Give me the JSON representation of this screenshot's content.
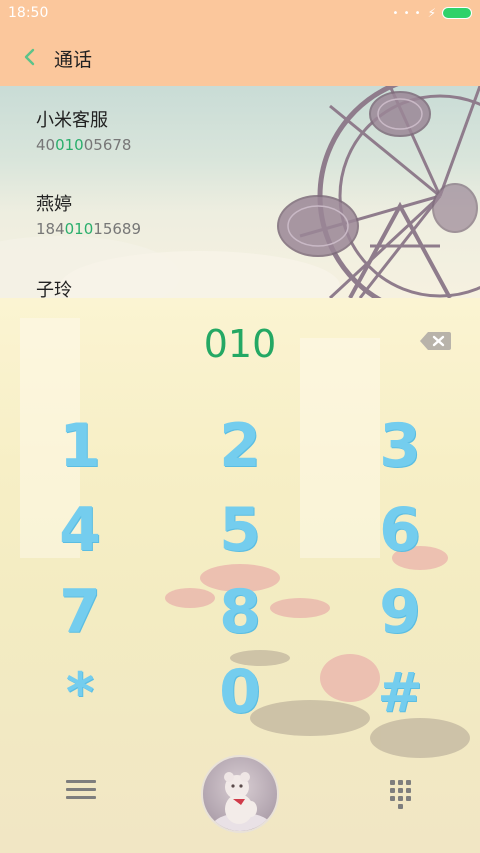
{
  "status_bar": {
    "time": "18:50"
  },
  "header": {
    "title": "通话"
  },
  "contacts": [
    {
      "name": "小米客服",
      "number_prefix": "40",
      "number_match": "010",
      "number_suffix": "05678"
    },
    {
      "name": "燕婷",
      "number_prefix": "184",
      "number_match": "010",
      "number_suffix": "15689"
    },
    {
      "name": "子玲",
      "number_prefix": "",
      "number_match": "",
      "number_suffix": ""
    }
  ],
  "dialer": {
    "display": "010",
    "keys": [
      "1",
      "2",
      "3",
      "4",
      "5",
      "6",
      "7",
      "8",
      "9",
      "*",
      "0",
      "#"
    ]
  },
  "colors": {
    "accent": "#24a864",
    "header_bg": "#fbc79c",
    "key_color": "#74cdee"
  },
  "icons": {
    "back": "chevron-left-icon",
    "backspace": "backspace-icon",
    "menu": "menu-icon",
    "call": "call-avatar-icon",
    "dialpad": "dialpad-icon"
  }
}
